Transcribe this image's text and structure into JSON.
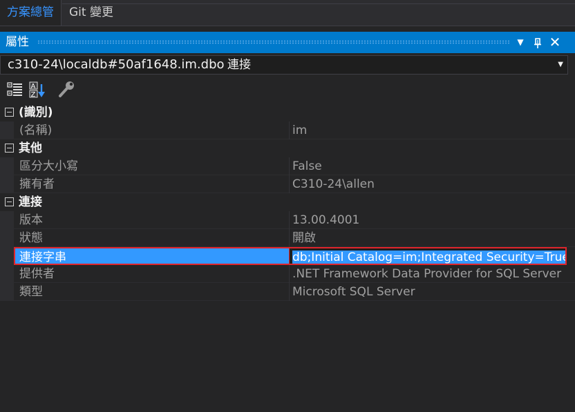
{
  "tabs": [
    {
      "label": "方案總管",
      "active": true
    },
    {
      "label": "Git 變更",
      "active": false
    }
  ],
  "panel": {
    "title": "屬性",
    "buttons": [
      "dropdown-arrow-icon",
      "pin-icon",
      "close-icon"
    ]
  },
  "selector": {
    "object_name": "c310-24\\localdb#50af1648.im.dbo",
    "object_type": "連接"
  },
  "toolbar": {
    "buttons": [
      "categorized-icon",
      "alphabetical-sort-icon",
      "property-pages-wrench-icon"
    ]
  },
  "grid": {
    "categories": [
      {
        "label": "(識別)",
        "properties": [
          {
            "name": "(名稱)",
            "value": "im"
          }
        ]
      },
      {
        "label": "其他",
        "properties": [
          {
            "name": "區分大小寫",
            "value": "False"
          },
          {
            "name": "擁有者",
            "value": "C310-24\\allen"
          }
        ]
      },
      {
        "label": "連接",
        "properties": [
          {
            "name": "版本",
            "value": "13.00.4001"
          },
          {
            "name": "狀態",
            "value": "開啟"
          },
          {
            "name": "連接字串",
            "value": "db;Initial Catalog=im;Integrated Security=True",
            "selected": true
          },
          {
            "name": "提供者",
            "value": ".NET Framework Data Provider for SQL Server"
          },
          {
            "name": "類型",
            "value": "Microsoft SQL Server"
          }
        ]
      }
    ]
  },
  "colors": {
    "accent": "#007acc",
    "selection": "#3399ff",
    "highlight_border": "#e0242a",
    "background": "#252526"
  }
}
